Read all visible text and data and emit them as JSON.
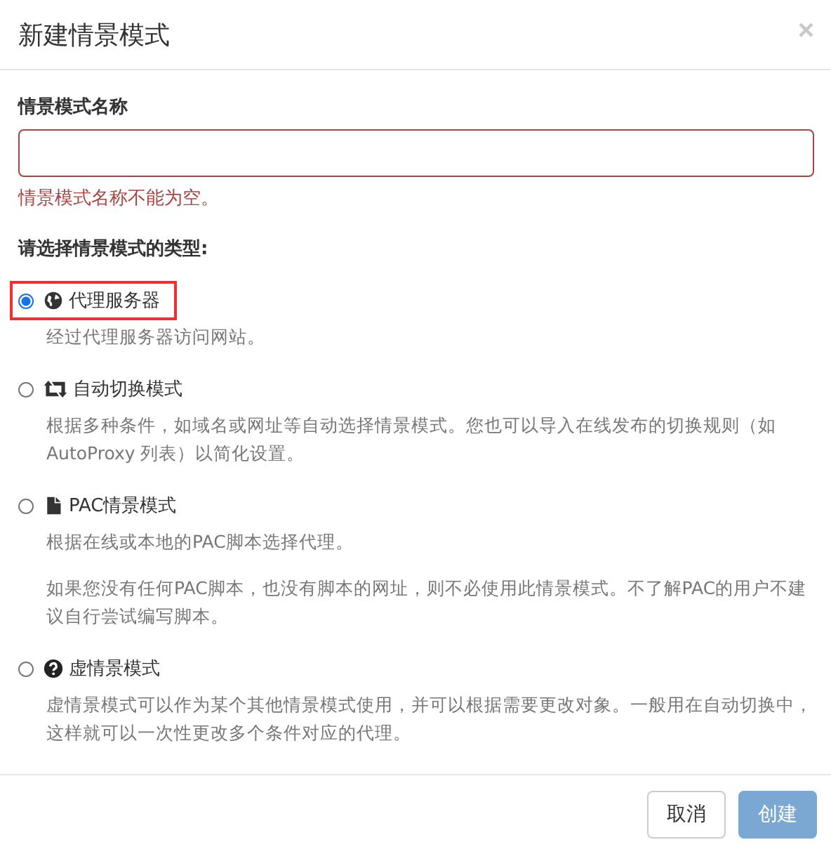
{
  "dialog": {
    "title": "新建情景模式",
    "close": "×"
  },
  "name_field": {
    "label": "情景模式名称",
    "invalid": true,
    "error": "情景模式名称不能为空。"
  },
  "type_label": "请选择情景模式的类型:",
  "options": [
    {
      "kind": "globe",
      "label": "代理服务器",
      "selected": true,
      "highlighted": true,
      "descriptions": [
        "经过代理服务器访问网站。"
      ]
    },
    {
      "kind": "switch",
      "label": "自动切换模式",
      "selected": false,
      "highlighted": false,
      "descriptions": [
        "根据多种条件，如域名或网址等自动选择情景模式。您也可以导入在线发布的切换规则（如 AutoProxy 列表）以简化设置。"
      ]
    },
    {
      "kind": "file",
      "label": "PAC情景模式",
      "selected": false,
      "highlighted": false,
      "descriptions": [
        "根据在线或本地的PAC脚本选择代理。",
        "如果您没有任何PAC脚本，也没有脚本的网址，则不必使用此情景模式。不了解PAC的用户不建议自行尝试编写脚本。"
      ]
    },
    {
      "kind": "question",
      "label": "虚情景模式",
      "selected": false,
      "highlighted": false,
      "descriptions": [
        "虚情景模式可以作为某个其他情景模式使用，并可以根据需要更改对象。一般用在自动切换中，这样就可以一次性更改多个条件对应的代理。"
      ]
    }
  ],
  "buttons": [
    {
      "label": "取消",
      "kind": "default",
      "disabled": false
    },
    {
      "label": "创建",
      "kind": "primary",
      "disabled": true
    }
  ]
}
